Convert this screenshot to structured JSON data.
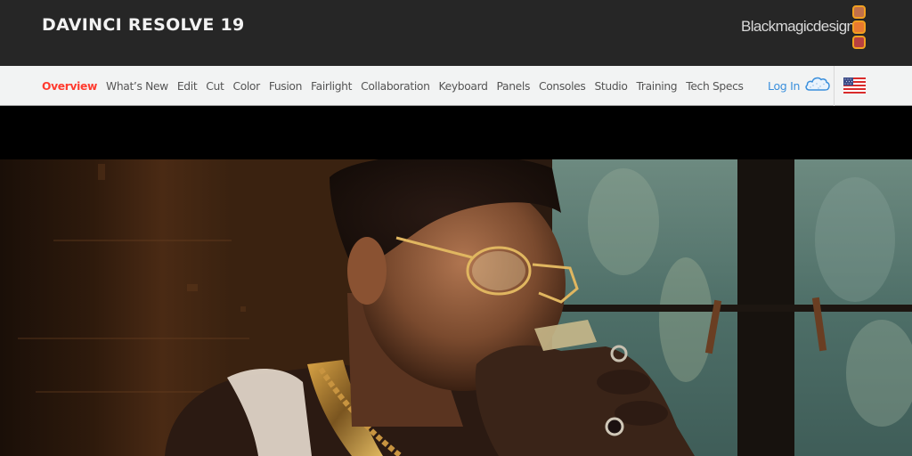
{
  "header": {
    "product_title": "DAVINCI RESOLVE 19",
    "brand_name": "Blackmagicdesign",
    "brand_square_colors": [
      "#c0704a",
      "#e87a30",
      "#b84040"
    ],
    "brand_square_border": "#f0a020"
  },
  "nav": {
    "items": [
      {
        "label": "Overview",
        "active": true
      },
      {
        "label": "What’s New",
        "active": false
      },
      {
        "label": "Edit",
        "active": false
      },
      {
        "label": "Cut",
        "active": false
      },
      {
        "label": "Color",
        "active": false
      },
      {
        "label": "Fusion",
        "active": false
      },
      {
        "label": "Fairlight",
        "active": false
      },
      {
        "label": "Collaboration",
        "active": false
      },
      {
        "label": "Keyboard",
        "active": false
      },
      {
        "label": "Panels",
        "active": false
      },
      {
        "label": "Consoles",
        "active": false
      },
      {
        "label": "Studio",
        "active": false
      },
      {
        "label": "Training",
        "active": false
      },
      {
        "label": "Tech Specs",
        "active": false
      }
    ],
    "login_label": "Log In",
    "login_icon": "cloud-icon",
    "region_icon": "us-flag-icon",
    "active_color": "#ff3b2f",
    "link_color": "#3a8fdc"
  },
  "hero": {
    "description": "Video still: tattooed man with gold glasses and chains beside a window with forest view"
  }
}
